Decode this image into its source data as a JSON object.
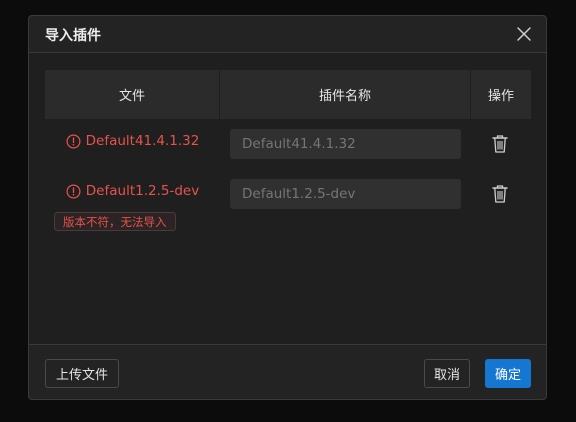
{
  "dialog": {
    "title": "导入插件",
    "close_icon": "close-icon"
  },
  "table": {
    "headers": {
      "file": "文件",
      "plugin_name": "插件名称",
      "action": "操作"
    },
    "rows": [
      {
        "file": "Default41.4.1.32",
        "status_icon": "warning-circle-icon",
        "name_placeholder": "Default41.4.1.32",
        "name_value": "",
        "action_icon": "trash-icon",
        "error": ""
      },
      {
        "file": "Default1.2.5-dev",
        "status_icon": "warning-circle-icon",
        "name_placeholder": "Default1.2.5-dev",
        "name_value": "",
        "action_icon": "trash-icon",
        "error": "版本不符，无法导入"
      }
    ]
  },
  "footer": {
    "upload_label": "上传文件",
    "cancel_label": "取消",
    "ok_label": "确定"
  },
  "colors": {
    "background": "#1f1f1f",
    "header_bg": "#2b2b2b",
    "error": "#e5534b",
    "primary": "#1677d3"
  }
}
